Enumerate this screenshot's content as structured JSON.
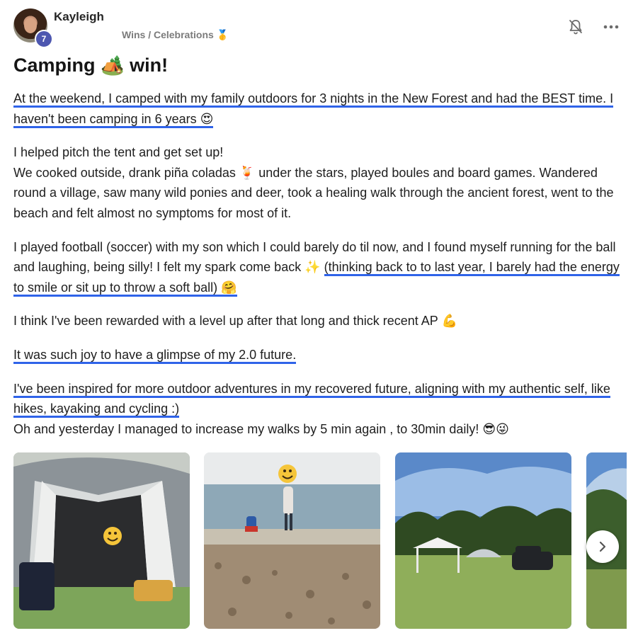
{
  "post": {
    "author": "Kayleigh",
    "level": "7",
    "category": "Wins / Celebrations 🥇",
    "title": "Camping 🏕️ win!",
    "icons": {
      "notify": "bell-slash-icon",
      "more": "more-dots-icon",
      "next": "chevron-right-icon"
    },
    "accent_color": "#2f63e9",
    "badge_color": "#4d57b0"
  },
  "body": {
    "p1": "At the weekend, I camped with my family outdoors for 3 nights in the New Forest and had the BEST time. I haven't been camping in 6 years 😍",
    "p2a": "I helped pitch the tent and get set up!",
    "p2b": "We cooked outside, drank piña coladas 🍹 under the stars, played boules and board games. Wandered round a village, saw many wild ponies and deer, took a healing walk through the ancient forest, went to the beach and felt almost no symptoms for most of it.",
    "p3a": "I played football (soccer) with my son which I could barely do til now, and I found myself running for the ball and laughing, being silly! I felt my spark come back ✨ ",
    "p3b": "(thinking back to to last year, I barely had the energy to smile or sit up to throw a soft ball) 🤗",
    "p4": "I think I've been rewarded with a level up after that long and thick recent AP 💪",
    "p5": "It was such joy to have a glimpse of my 2.0 future.",
    "p6a": "I've been inspired for more outdoor adventures in my recovered future, aligning with my authentic self, like hikes, kayaking and cycling :)",
    "p6b": "Oh and yesterday I managed to increase my walks by 5 min again , to 30min daily! 😎😜"
  },
  "gallery": {
    "photos": [
      "tent-interior-photo",
      "pebble-beach-photo",
      "campsite-gazebo-car-photo",
      "forest-edge-photo"
    ]
  }
}
